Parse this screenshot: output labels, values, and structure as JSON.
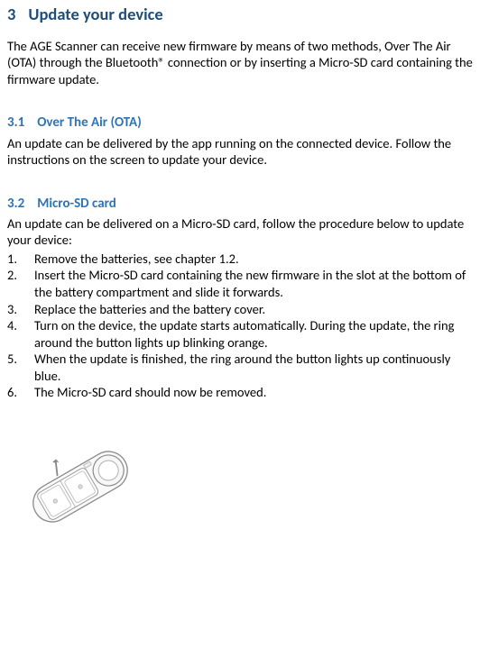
{
  "main": {
    "number": "3",
    "title": "Update your device",
    "intro": "The AGE Scanner can receive new firmware by means of two methods, Over The Air (OTA) through the Bluetooth® connection or by inserting a Micro-SD card containing the firmware update."
  },
  "section_ota": {
    "number": "3.1",
    "title": "Over The Air (OTA)",
    "body": "An update can be delivered by the app running on the connected device. Follow the instructions on the screen to update your device."
  },
  "section_sd": {
    "number": "3.2",
    "title": "Micro-SD card",
    "body": "An update can be delivered on a Micro-SD card, follow the procedure below to update your device:",
    "steps": [
      {
        "n": "1.",
        "t": "Remove the batteries, see chapter 1.2."
      },
      {
        "n": "2.",
        "t": "Insert the Micro-SD card containing the new firmware in the slot at the bottom of the battery compartment and slide it forwards."
      },
      {
        "n": "3.",
        "t": "Replace the batteries and the battery cover."
      },
      {
        "n": "4.",
        "t": "Turn on the device, the update starts automatically. During the update, the ring around the button lights up blinking orange."
      },
      {
        "n": "5.",
        "t": "When the update is finished, the ring around the button lights up continuously blue."
      },
      {
        "n": "6.",
        "t": "The Micro-SD card should now be removed."
      }
    ]
  },
  "figure": {
    "name": "device-battery-compartment-illustration"
  }
}
